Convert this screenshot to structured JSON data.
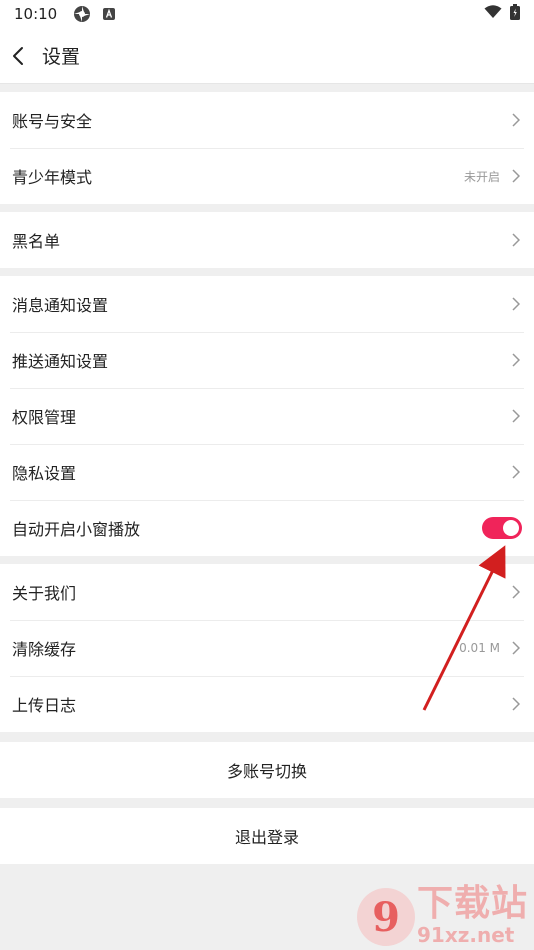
{
  "status_bar": {
    "time": "10:10",
    "icons": [
      "pinwheel-icon",
      "a-badge-icon",
      "wifi-icon",
      "battery-icon"
    ]
  },
  "header": {
    "title": "设置"
  },
  "groups": [
    {
      "items": [
        {
          "label": "账号与安全",
          "value": ""
        },
        {
          "label": "青少年模式",
          "value": "未开启"
        }
      ]
    },
    {
      "items": [
        {
          "label": "黑名单",
          "value": ""
        }
      ]
    },
    {
      "items": [
        {
          "label": "消息通知设置",
          "value": ""
        },
        {
          "label": "推送通知设置",
          "value": ""
        },
        {
          "label": "权限管理",
          "value": ""
        },
        {
          "label": "隐私设置",
          "value": ""
        },
        {
          "label": "自动开启小窗播放",
          "toggle": "on"
        }
      ]
    },
    {
      "items": [
        {
          "label": "关于我们",
          "value": ""
        },
        {
          "label": "清除缓存",
          "value": "0.01 M"
        },
        {
          "label": "上传日志",
          "value": ""
        }
      ]
    }
  ],
  "buttons": {
    "switch_account": "多账号切换",
    "logout": "退出登录"
  },
  "colors": {
    "toggle_on": "#f0245a",
    "annotation_arrow": "#d21f1f"
  },
  "watermark": {
    "logo": "9",
    "big": "下载站",
    "small": "91xz.net"
  }
}
